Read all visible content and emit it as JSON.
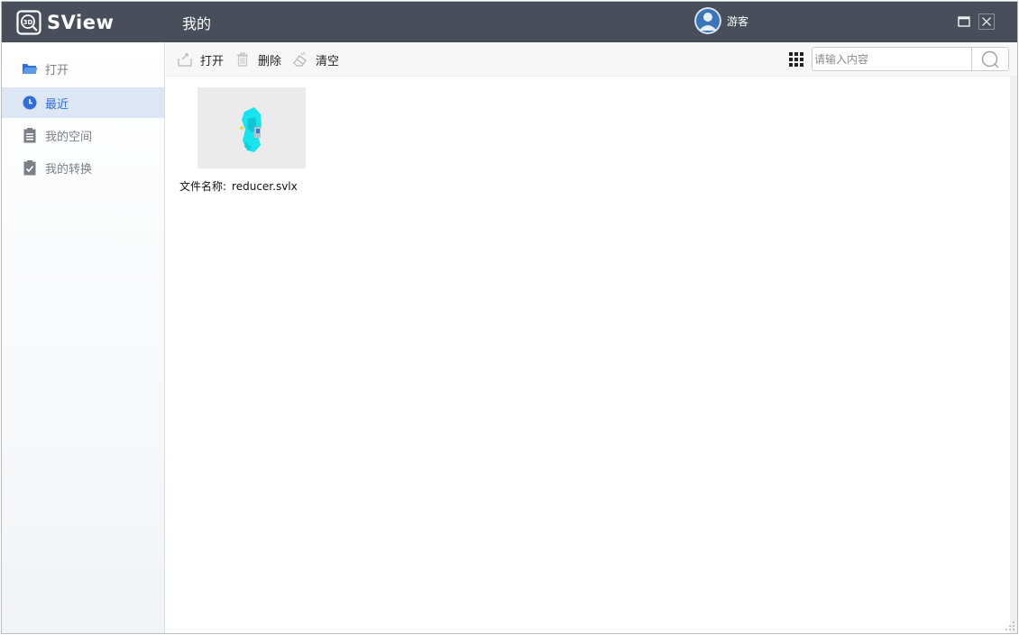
{
  "app": {
    "name": "SView",
    "page_title": "我的"
  },
  "user": {
    "name": "游客"
  },
  "window_controls": {
    "maximize_icon": "maximize-icon",
    "close_icon": "close-icon"
  },
  "sidebar": {
    "items": [
      {
        "label": "打开",
        "icon": "folder-open-icon",
        "active": false
      },
      {
        "label": "最近",
        "icon": "clock-icon",
        "active": true
      },
      {
        "label": "我的空间",
        "icon": "document-icon",
        "active": false
      },
      {
        "label": "我的转换",
        "icon": "clipboard-check-icon",
        "active": false
      }
    ]
  },
  "toolbar": {
    "open_label": "打开",
    "delete_label": "删除",
    "clear_label": "清空",
    "view_mode_icon": "grid-view-icon",
    "search_placeholder": "请输入内容",
    "search_value": ""
  },
  "files": [
    {
      "label_prefix": "文件名称:",
      "name": "reducer.svlx",
      "thumbnail": "3d-model-thumbnail"
    }
  ],
  "colors": {
    "titlebar": "#484f5a",
    "accent": "#2f6fdc",
    "active_item_bg": "#dce6f5",
    "thumb_bg": "#ebebeb",
    "model_cyan": "#19e3ef"
  }
}
